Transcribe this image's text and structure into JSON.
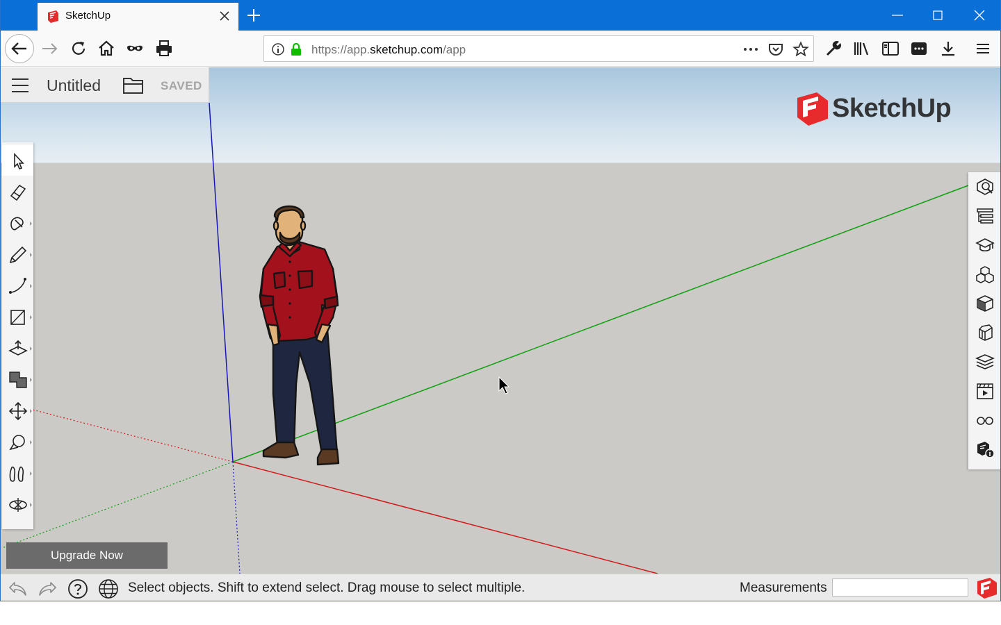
{
  "browser": {
    "tab_title": "SketchUp",
    "url_prefix": "https://app.",
    "url_host": "sketchup.com",
    "url_path": "/app"
  },
  "app": {
    "model_title": "Untitled",
    "save_status": "SAVED",
    "logo_text": "SketchUp",
    "upgrade_label": "Upgrade Now",
    "status_message": "Select objects. Shift to extend select. Drag mouse to select multiple.",
    "measurements_label": "Measurements",
    "measurements_value": ""
  },
  "left_toolbar": [
    {
      "name": "select-tool",
      "icon": "arrow-pointer-icon"
    },
    {
      "name": "eraser-tool",
      "icon": "eraser-icon"
    },
    {
      "name": "paint-bucket-tool",
      "icon": "paint-icon"
    },
    {
      "name": "pencil-tool",
      "icon": "pencil-icon"
    },
    {
      "name": "arc-tool",
      "icon": "arc-icon"
    },
    {
      "name": "rectangle-tool",
      "icon": "rectangle-icon"
    },
    {
      "name": "push-pull-tool",
      "icon": "push-pull-icon"
    },
    {
      "name": "offset-tool",
      "icon": "offset-icon"
    },
    {
      "name": "move-tool",
      "icon": "move-icon"
    },
    {
      "name": "tape-measure-tool",
      "icon": "tape-measure-icon"
    },
    {
      "name": "walk-tool",
      "icon": "footprints-icon"
    },
    {
      "name": "orbit-tool",
      "icon": "orbit-icon"
    }
  ],
  "right_toolbar": [
    {
      "name": "entity-info-panel",
      "icon": "entity-info-icon"
    },
    {
      "name": "outliner-panel",
      "icon": "outliner-icon"
    },
    {
      "name": "instructor-panel",
      "icon": "graduation-cap-icon"
    },
    {
      "name": "components-panel",
      "icon": "components-icon"
    },
    {
      "name": "materials-panel",
      "icon": "materials-cube-icon"
    },
    {
      "name": "styles-panel",
      "icon": "styles-icon"
    },
    {
      "name": "layers-panel",
      "icon": "layers-icon"
    },
    {
      "name": "scenes-panel",
      "icon": "scenes-icon"
    },
    {
      "name": "display-panel",
      "icon": "glasses-icon"
    },
    {
      "name": "model-info-panel",
      "icon": "model-info-icon"
    }
  ],
  "colors": {
    "titlebar": "#0a6fd6",
    "sky": "#a8c6de",
    "ground": "#cbcac6",
    "axis_red": "#d11a1a",
    "axis_green": "#10a010",
    "axis_blue": "#1717b8",
    "brand_red": "#e72b2d",
    "shirt_red": "#a3121c",
    "jeans": "#1f2740"
  }
}
